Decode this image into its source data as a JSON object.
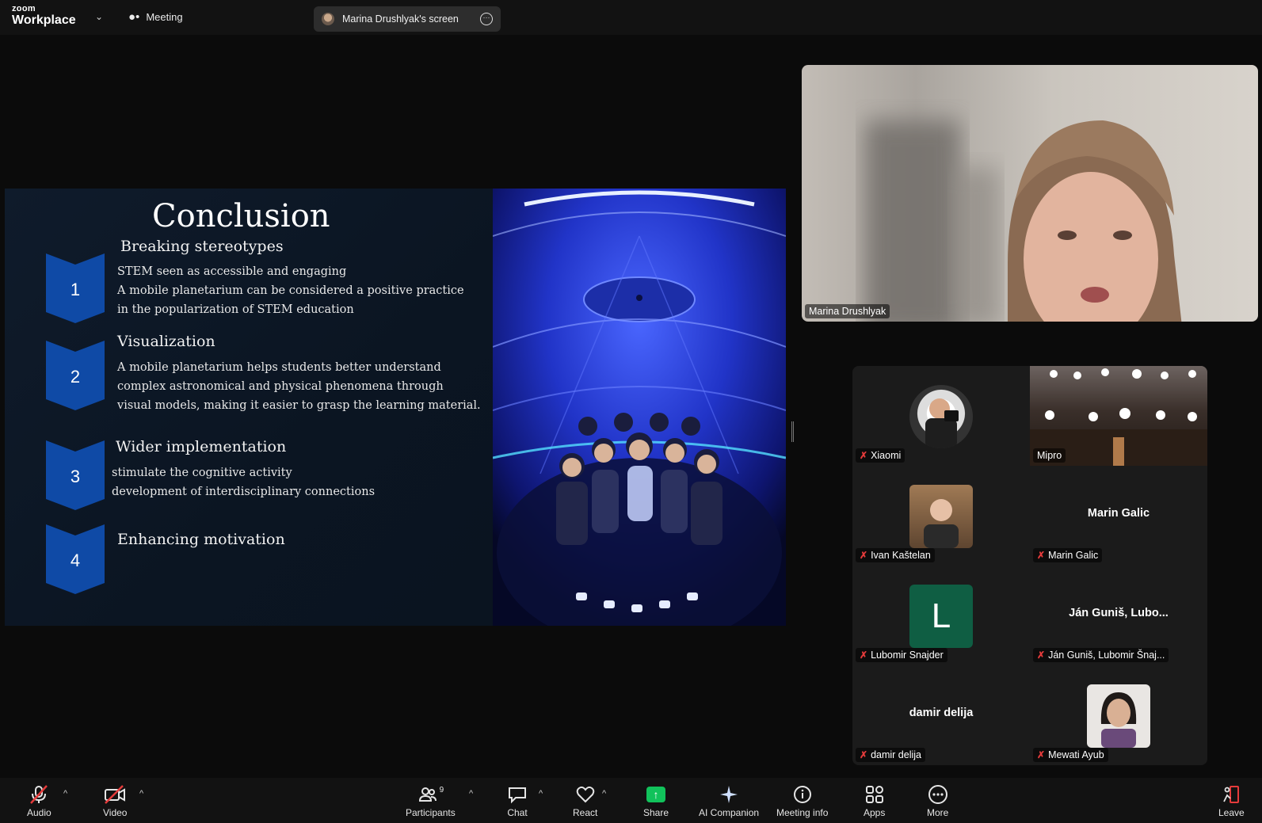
{
  "topbar": {
    "logo_small": "zoom",
    "logo_big": "Workplace",
    "meeting_label": "Meeting",
    "screen_share_label": "Marina Drushlyak's screen"
  },
  "slide": {
    "title": "Conclusion",
    "sections": [
      {
        "number": "1",
        "heading": "Breaking stereotypes",
        "lines": [
          "STEM seen as accessible and engaging",
          "A mobile planetarium can be considered a positive practice",
          "in the popularization of STEM education"
        ]
      },
      {
        "number": "2",
        "heading": "Visualization",
        "lines": [
          "A mobile planetarium helps students better understand",
          "complex astronomical and physical phenomena through",
          "visual models, making it easier to grasp the learning material."
        ]
      },
      {
        "number": "3",
        "heading": "Wider implementation",
        "lines": [
          "stimulate the cognitive activity",
          "development of interdisciplinary connections"
        ]
      },
      {
        "number": "4",
        "heading": "Enhancing motivation",
        "lines": []
      }
    ],
    "accent_color": "#0f4aa6"
  },
  "speaker": {
    "name": "Marina Drushlyak"
  },
  "gallery": [
    {
      "name": "Xiaomi",
      "type": "photo"
    },
    {
      "name": "Mipro",
      "type": "video"
    },
    {
      "name": "Ivan Kaštelan",
      "type": "photo"
    },
    {
      "name": "Marin Galic",
      "type": "text",
      "display": "Marin Galic"
    },
    {
      "name": "Lubomir Snajder",
      "type": "letter",
      "letter": "L"
    },
    {
      "name": "Ján Guniš, Lubomir Šnaj...",
      "type": "text",
      "display": "Ján Guniš, Lubo..."
    },
    {
      "name": "damir delija",
      "type": "text",
      "display": "damir delija"
    },
    {
      "name": "Mewati Ayub",
      "type": "photo"
    }
  ],
  "toolbar": {
    "audio": "Audio",
    "video": "Video",
    "participants": "Participants",
    "participants_count": "9",
    "chat": "Chat",
    "react": "React",
    "share": "Share",
    "ai_companion": "AI Companion",
    "meeting_info": "Meeting info",
    "apps": "Apps",
    "more": "More",
    "leave": "Leave",
    "share_color": "#11c25b",
    "leave_color": "#e53b3b"
  }
}
